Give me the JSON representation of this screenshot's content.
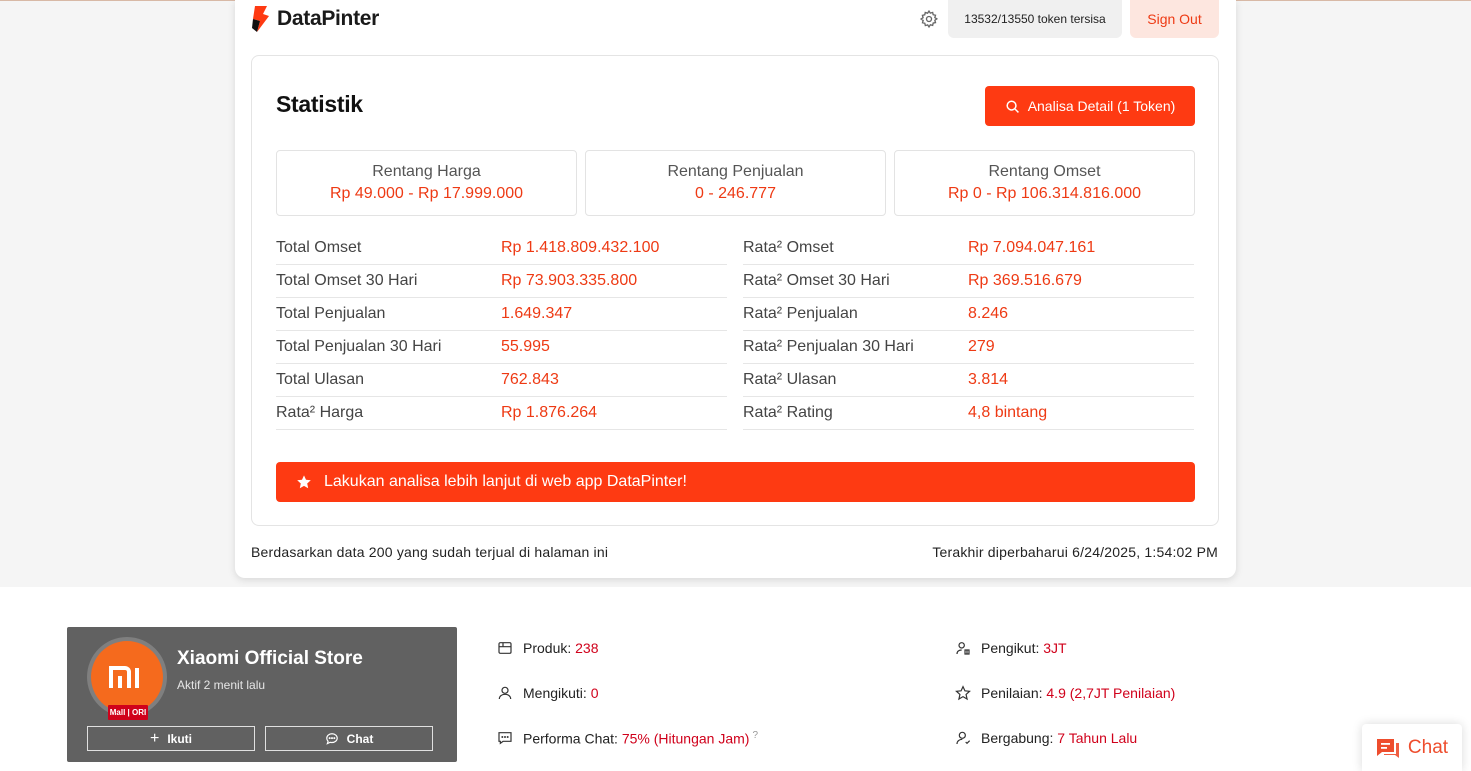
{
  "brand": {
    "name": "DataPinter"
  },
  "header": {
    "tokens": "13532/13550 token tersisa",
    "sign_out": "Sign Out"
  },
  "stats": {
    "title": "Statistik",
    "detail_button": "Analisa Detail (1 Token)",
    "ranges": [
      {
        "label": "Rentang Harga",
        "value": "Rp 49.000 - Rp 17.999.000"
      },
      {
        "label": "Rentang Penjualan",
        "value": "0 - 246.777"
      },
      {
        "label": "Rentang Omset",
        "value": "Rp 0 - Rp 106.314.816.000"
      }
    ],
    "left": [
      {
        "label": "Total Omset",
        "value": "Rp 1.418.809.432.100"
      },
      {
        "label": "Total Omset 30 Hari",
        "value": "Rp 73.903.335.800"
      },
      {
        "label": "Total Penjualan",
        "value": "1.649.347"
      },
      {
        "label": "Total Penjualan 30 Hari",
        "value": "55.995"
      },
      {
        "label": "Total Ulasan",
        "value": "762.843"
      },
      {
        "label": "Rata² Harga",
        "value": "Rp 1.876.264"
      }
    ],
    "right": [
      {
        "label": "Rata² Omset",
        "value": "Rp 7.094.047.161"
      },
      {
        "label": "Rata² Omset 30 Hari",
        "value": "Rp 369.516.679"
      },
      {
        "label": "Rata² Penjualan",
        "value": "8.246"
      },
      {
        "label": "Rata² Penjualan 30 Hari",
        "value": "279"
      },
      {
        "label": "Rata² Ulasan",
        "value": "3.814"
      },
      {
        "label": "Rata² Rating",
        "value": "4,8 bintang"
      }
    ],
    "cta": "Lakukan analisa lebih lanjut di web app DataPinter!",
    "footer_left": "Berdasarkan data 200 yang sudah terjual di halaman ini",
    "footer_right": "Terakhir diperbaharui 6/24/2025, 1:54:02 PM"
  },
  "shop": {
    "name": "Xiaomi Official Store",
    "active": "Aktif 2 menit lalu",
    "badge": "Mall | ORI",
    "follow_button": "Ikuti",
    "chat_button": "Chat",
    "info": [
      {
        "label": "Produk:",
        "value": "238",
        "icon": "store-icon"
      },
      {
        "label": "Pengikut:",
        "value": "3JT",
        "icon": "followers-icon"
      },
      {
        "label": "Mengikuti:",
        "value": "0",
        "icon": "user-icon"
      },
      {
        "label": "Penilaian:",
        "value": "4.9 (2,7JT Penilaian)",
        "icon": "star-icon"
      },
      {
        "label": "Performa Chat:",
        "value": "75% (Hitungan Jam)",
        "icon": "chat-bubble-icon"
      },
      {
        "label": "Bergabung:",
        "value": "7 Tahun Lalu",
        "icon": "user-joined-icon"
      }
    ]
  },
  "floating_chat": {
    "label": "Chat"
  },
  "colors": {
    "accent": "#fe3a12",
    "value_red": "#ee3a14",
    "shop_red": "#d0011b",
    "shop_card": "#616161"
  }
}
